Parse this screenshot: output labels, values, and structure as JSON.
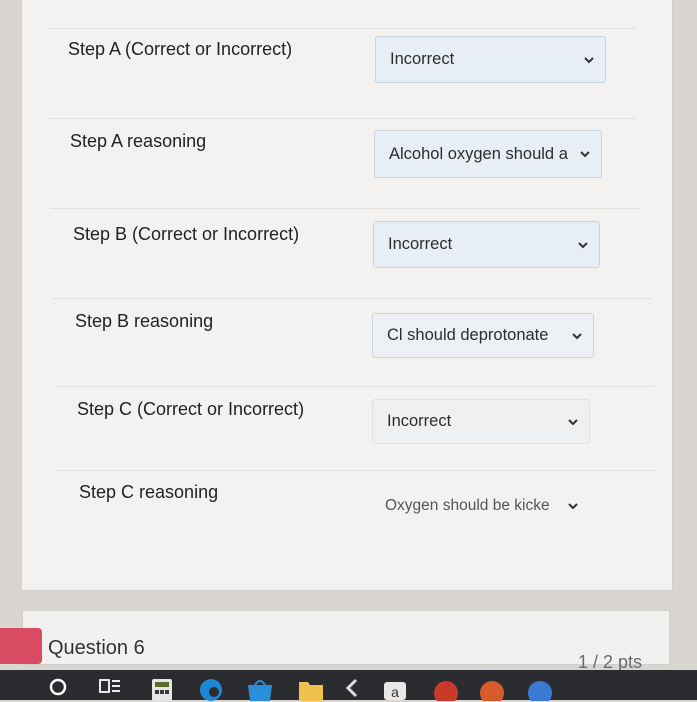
{
  "rows": [
    {
      "label": "Step A (Correct or Incorrect)",
      "value": "Incorrect"
    },
    {
      "label": "Step A reasoning",
      "value": "Alcohol oxygen should a"
    },
    {
      "label": "Step B (Correct or Incorrect)",
      "value": "Incorrect"
    },
    {
      "label": "Step B reasoning",
      "value": "Cl should deprotonate"
    },
    {
      "label": "Step C (Correct or Incorrect)",
      "value": "Incorrect"
    },
    {
      "label": "Step C reasoning",
      "value": "Oxygen should be kicke"
    }
  ],
  "question": {
    "title": "Question 6",
    "points": "1 / 2 pts"
  },
  "taskbar": {
    "letter_icon": "a"
  },
  "colors": {
    "accent_tab": "#d94b63",
    "select_bg": "#e8eef6",
    "panel_bg": "#f3f2f0"
  },
  "icons": [
    "chevron-down-icon",
    "search-circle-icon",
    "task-view-icon",
    "calculator-icon",
    "edge-icon",
    "store-icon",
    "folder-icon",
    "back-icon",
    "app-icon"
  ]
}
